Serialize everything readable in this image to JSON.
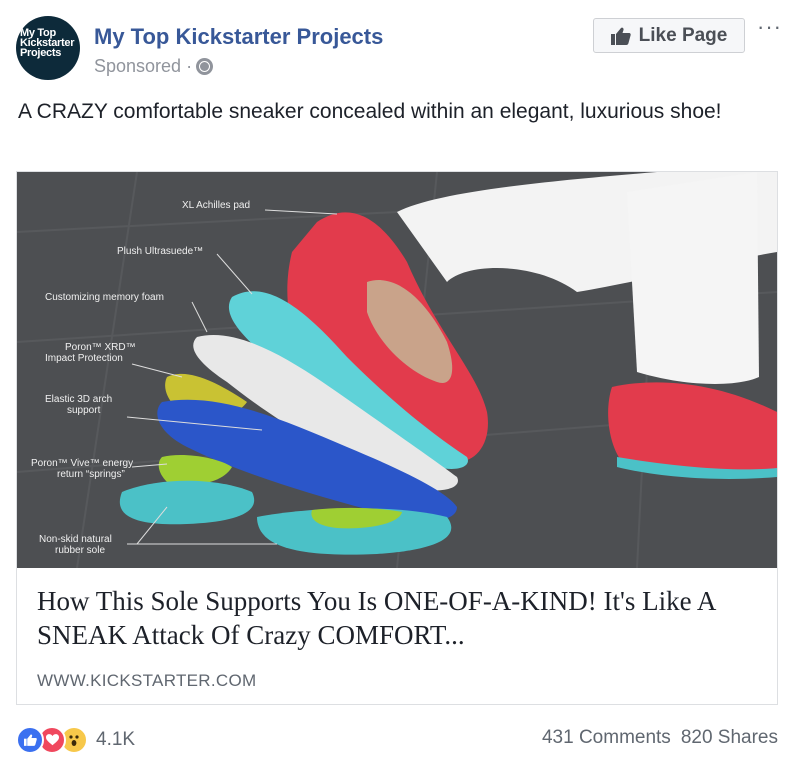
{
  "header": {
    "avatar_text": "My Top Kickstarter Projects",
    "page_name": "My Top Kickstarter Projects",
    "sponsored_label": "Sponsored ·",
    "like_button_label": "Like Page",
    "more_label": "···"
  },
  "post": {
    "text": "A CRAZY comfortable sneaker concealed within an elegant, luxurious shoe!"
  },
  "card": {
    "image_labels": [
      "XL Achilles pad",
      "Plush Ultrasuede™",
      "Customizing memory foam",
      "Poron™ XRD™",
      "Impact Protection",
      "Elastic 3D arch",
      "support",
      "Poron™ Vive™ energy",
      "return “springs”",
      "Non-skid natural",
      "rubber sole"
    ],
    "title": "How This Sole Supports You Is ONE-OF-A-KIND! It's Like A SNEAK Attack Of Crazy COMFORT...",
    "domain": "WWW.KICKSTARTER.COM"
  },
  "footer": {
    "reaction_icons": [
      "like-icon",
      "love-icon",
      "wow-icon"
    ],
    "reaction_count": "4.1K",
    "comments": "431 Comments",
    "shares": "820 Shares"
  },
  "colors": {
    "brand_link": "#385898",
    "muted_text": "#606770",
    "like_reaction": "#3b70f0",
    "love_reaction": "#f0485e",
    "wow_reaction": "#f7c84a"
  }
}
